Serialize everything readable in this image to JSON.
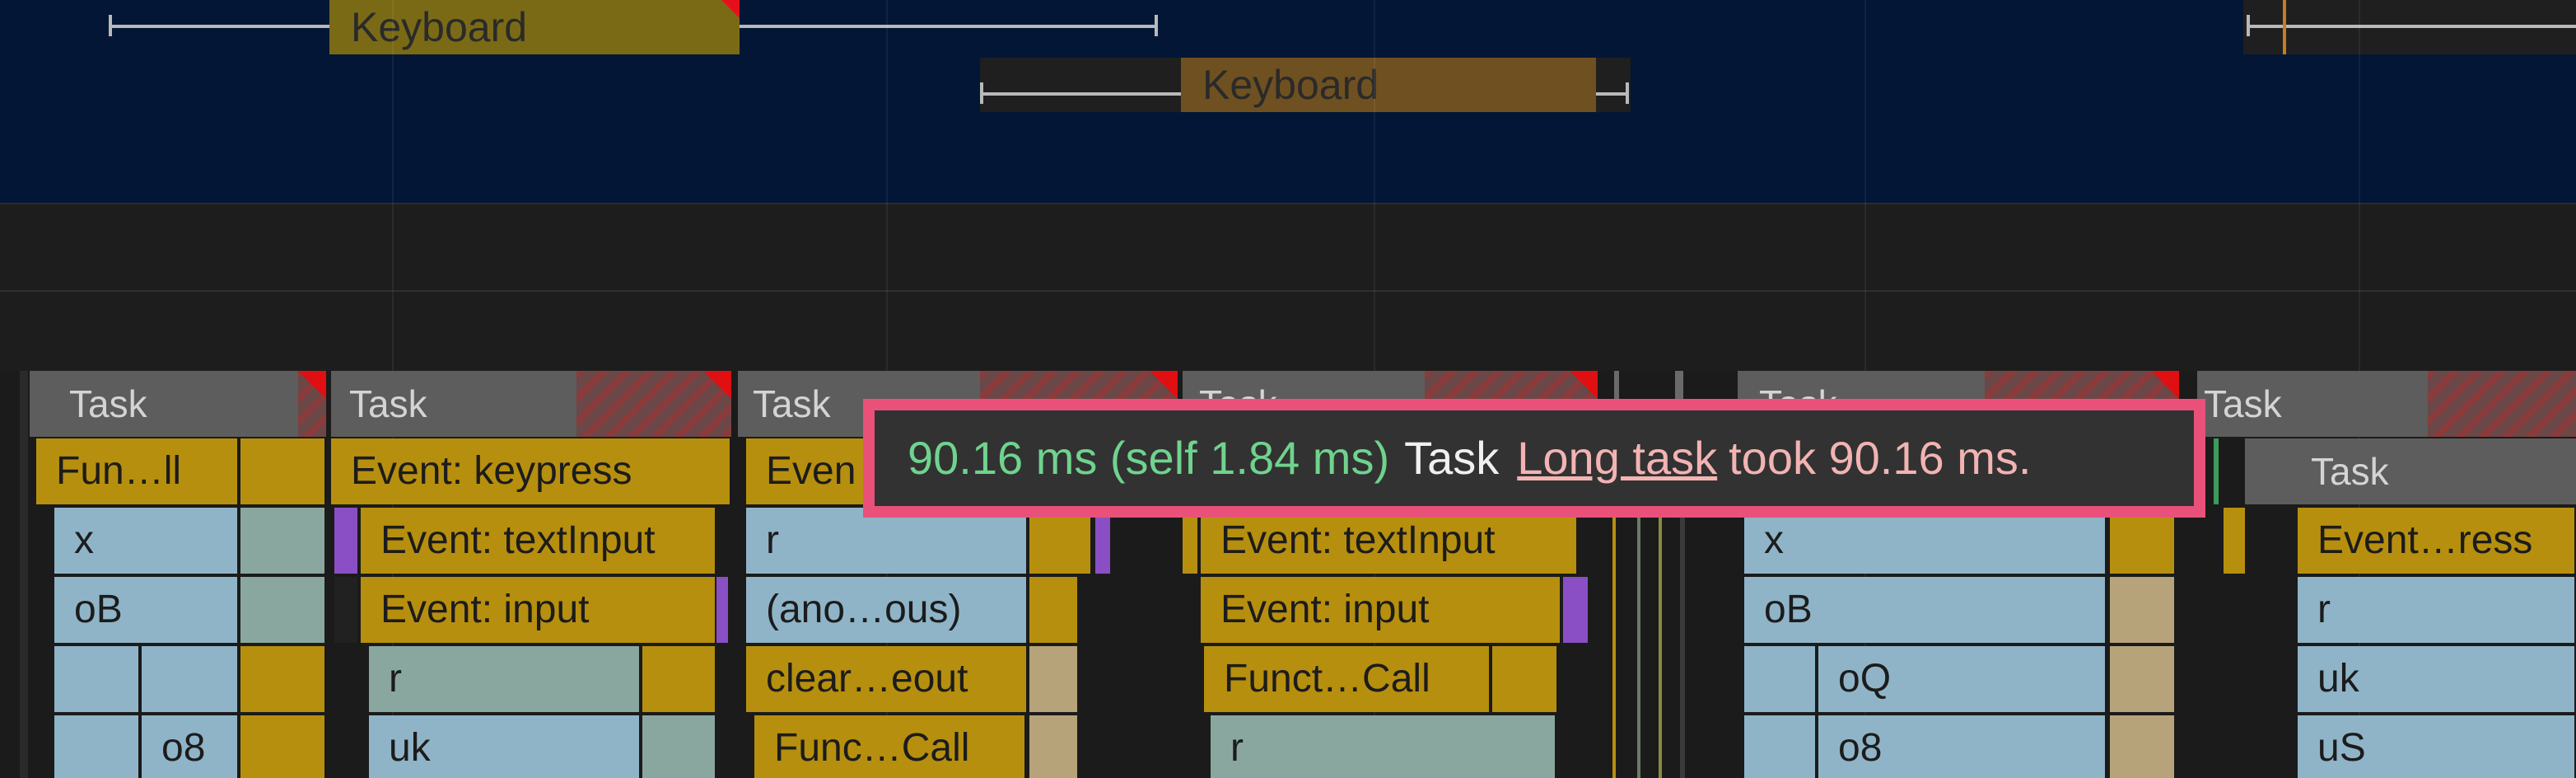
{
  "interactions": [
    {
      "label": "Keyboard"
    },
    {
      "label": "Keyboard"
    }
  ],
  "tasks": [
    {
      "label": "Task"
    },
    {
      "label": "Task"
    },
    {
      "label": "Task"
    },
    {
      "label": "Task"
    },
    {
      "label": "Task"
    },
    {
      "label": "Task"
    },
    {
      "label": "Task"
    }
  ],
  "blocks": {
    "c1": [
      "Fun…ll",
      "x",
      "oB",
      "",
      "o8"
    ],
    "c2": [
      "Event: keypress",
      "Event: textInput",
      "Event: input",
      "r",
      "uk"
    ],
    "c3": [
      "Even",
      "r",
      "(ano…ous)",
      "clear…eout",
      "Func…Call"
    ],
    "c4": [
      "Event: textInput",
      "Event: input",
      "Funct…Call",
      "r"
    ],
    "c5": [
      "x",
      "oB",
      "oQ",
      "o8"
    ],
    "c6": [
      "Task",
      "Event…ress",
      "r",
      "uk",
      "uS"
    ]
  },
  "tooltip": {
    "duration": "90.16 ms (self 1.84 ms)",
    "name": "Task",
    "link": "Long task",
    "message": "took 90.16 ms."
  },
  "colors": {
    "interaction_band": "#031636",
    "long_task_border": "#e9517a",
    "yellow_block": "#b78f0e",
    "blue_block": "#8fb4c8"
  }
}
